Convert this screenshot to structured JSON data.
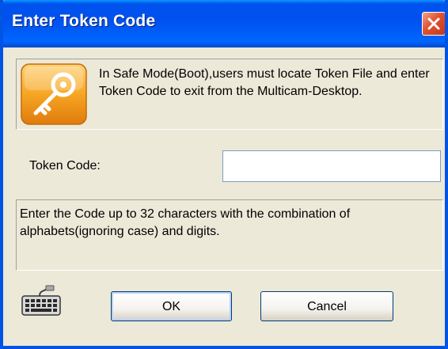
{
  "window": {
    "title": "Enter Token Code"
  },
  "info": {
    "icon": "key-icon",
    "message": "In Safe Mode(Boot),users must locate Token File and enter Token Code to exit from the Multicam-Desktop."
  },
  "token": {
    "label": "Token Code:",
    "value": "",
    "placeholder": ""
  },
  "hint": {
    "message": "Enter the Code up to 32 characters with the combination of alphabets(ignoring case) and digits."
  },
  "buttons": {
    "ok_label": "OK",
    "cancel_label": "Cancel"
  },
  "icons": {
    "keyboard": "keyboard-icon",
    "close": "close-icon"
  },
  "colors": {
    "titlebar": "#0054E3",
    "close": "#E0512E",
    "key_icon": "#F6A623",
    "dialog_bg": "#ECE9D8"
  }
}
